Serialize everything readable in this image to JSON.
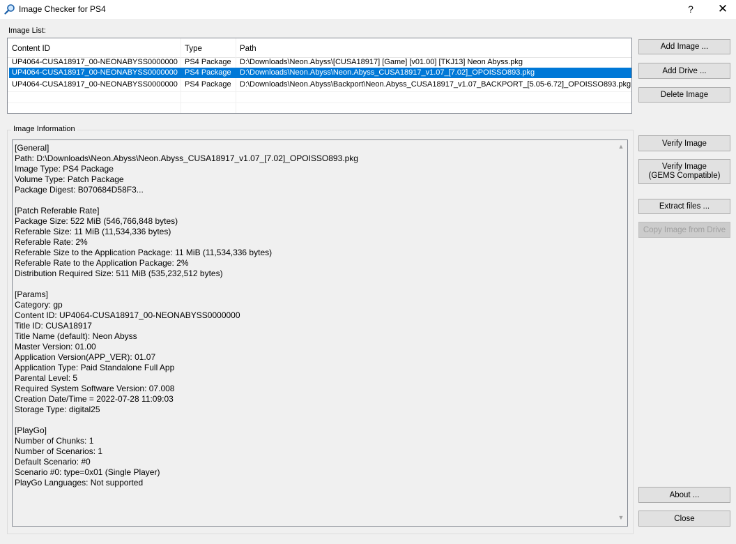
{
  "window": {
    "title": "Image Checker for PS4",
    "help_label": "?",
    "close_label": "✕"
  },
  "image_list": {
    "label": "Image List:",
    "columns": [
      "Content ID",
      "Type",
      "Path"
    ],
    "rows": [
      {
        "content_id": "UP4064-CUSA18917_00-NEONABYSS0000000",
        "type": "PS4 Package",
        "path": "D:\\Downloads\\Neon.Abyss\\[CUSA18917] [Game] [v01.00] [TKJ13] Neon Abyss.pkg"
      },
      {
        "content_id": "UP4064-CUSA18917_00-NEONABYSS0000000",
        "type": "PS4 Package",
        "path": "D:\\Downloads\\Neon.Abyss\\Neon.Abyss_CUSA18917_v1.07_[7.02]_OPOISSO893.pkg"
      },
      {
        "content_id": "UP4064-CUSA18917_00-NEONABYSS0000000",
        "type": "PS4 Package",
        "path": "D:\\Downloads\\Neon.Abyss\\Backport\\Neon.Abyss_CUSA18917_v1.07_BACKPORT_[5.05-6.72]_OPOISSO893.pkg"
      }
    ],
    "selected_index": 1
  },
  "image_info": {
    "label": "Image Information",
    "lines": [
      "[General]",
      "Path: D:\\Downloads\\Neon.Abyss\\Neon.Abyss_CUSA18917_v1.07_[7.02]_OPOISSO893.pkg",
      "Image Type: PS4 Package",
      "Volume Type: Patch Package",
      "Package Digest: B070684D58F3...",
      "",
      "[Patch Referable Rate]",
      "Package Size: 522 MiB (546,766,848 bytes)",
      "Referable Size: 11 MiB (11,534,336 bytes)",
      "Referable Rate: 2%",
      "Referable Size to the Application Package: 11 MiB (11,534,336 bytes)",
      "Referable Rate to the Application Package: 2%",
      "Distribution Required Size: 511 MiB (535,232,512 bytes)",
      "",
      "[Params]",
      "Category: gp",
      "Content ID: UP4064-CUSA18917_00-NEONABYSS0000000",
      "Title ID: CUSA18917",
      "Title Name (default): Neon Abyss",
      "Master Version: 01.00",
      "Application Version(APP_VER): 01.07",
      "Application Type: Paid Standalone Full App",
      "Parental Level: 5",
      "Required System Software Version: 07.008",
      "Creation Date/Time = 2022-07-28 11:09:03",
      "Storage Type: digital25",
      "",
      "[PlayGo]",
      "Number of Chunks: 1",
      "Number of Scenarios: 1",
      "Default Scenario: #0",
      "Scenario #0: type=0x01 (Single Player)",
      "PlayGo Languages: Not supported"
    ]
  },
  "buttons": {
    "add_image": "Add Image ...",
    "add_drive": "Add Drive ...",
    "delete_image": "Delete Image",
    "verify_image": "Verify Image",
    "verify_gems_line1": "Verify Image",
    "verify_gems_line2": "(GEMS Compatible)",
    "extract_files": "Extract files ...",
    "copy_image": "Copy Image from Drive",
    "about": "About ...",
    "close": "Close"
  },
  "icons": {
    "app": "magnifier-icon",
    "scroll_up": "scroll-up-arrow-icon",
    "scroll_down": "scroll-down-arrow-icon"
  },
  "colors": {
    "selection": "#0078d7",
    "window_bg": "#f0f0f0",
    "disabled_text": "#a0a0a0"
  }
}
